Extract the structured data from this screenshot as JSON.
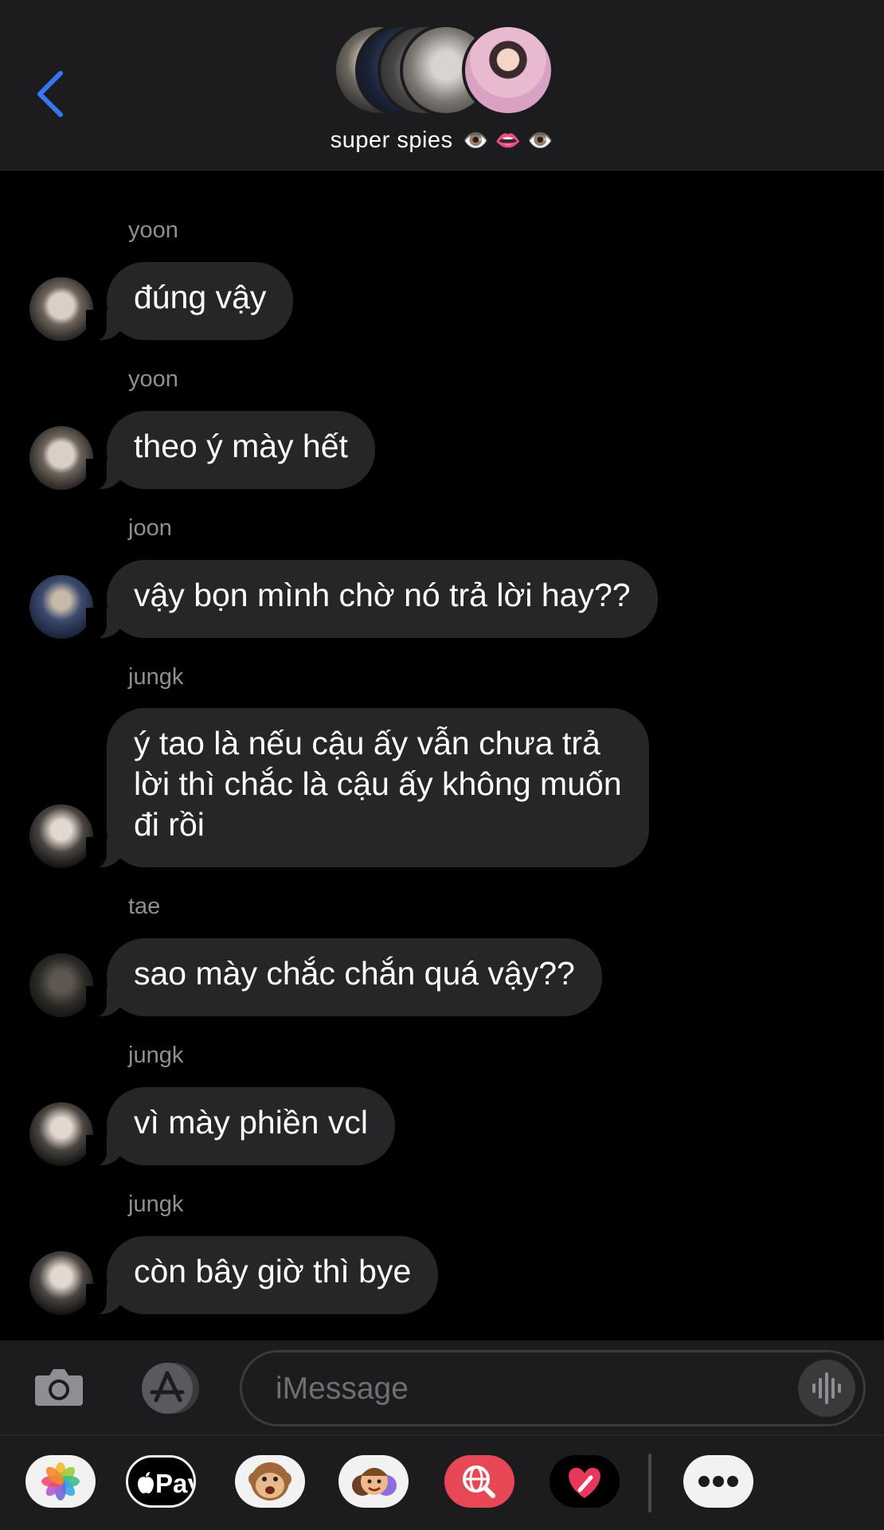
{
  "header": {
    "back_icon": "chevron-left-icon",
    "title": "super spies",
    "title_emojis": "👁️ 👄 👁️",
    "member_avatars": [
      "yoon",
      "joon",
      "jungk",
      "tae",
      "jimin"
    ]
  },
  "messages": [
    {
      "sender": "yoon",
      "text": "đúng vậy"
    },
    {
      "sender": "yoon",
      "text": "theo ý mày hết"
    },
    {
      "sender": "joon",
      "text": "vậy bọn mình chờ nó trả lời hay??"
    },
    {
      "sender": "jungk",
      "text": "ý tao là nếu cậu ấy vẫn chưa trả\nlời thì chắc là cậu ấy không muốn\nđi rồi"
    },
    {
      "sender": "tae",
      "text": "sao mày chắc chắn quá vậy??"
    },
    {
      "sender": "jungk",
      "text": "vì mày phiền vcl"
    },
    {
      "sender": "jungk",
      "text": "còn bây giờ thì bye"
    }
  ],
  "input": {
    "placeholder": "iMessage",
    "camera_icon": "camera-icon",
    "appstore_icon": "app-store-icon",
    "audio_icon": "audio-waveform-icon"
  },
  "app_drawer": {
    "apps": [
      "photos-app",
      "apple-pay-app",
      "animoji-app",
      "memoji-app",
      "search-images-app",
      "digital-touch-app",
      "more-apps"
    ],
    "apple_pay_label": "Pay"
  },
  "colors": {
    "background": "#000000",
    "bubble": "#262628",
    "bar": "#1c1c1e",
    "accent_blue": "#3478f6",
    "sender_gray": "#8e8e93"
  }
}
